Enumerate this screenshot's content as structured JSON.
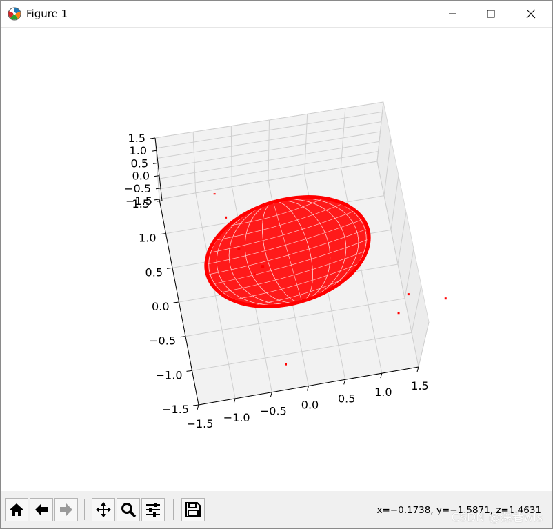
{
  "window": {
    "title": "Figure 1",
    "icon": "matplotlib-icon",
    "controls": [
      "minimize-icon",
      "maximize-icon",
      "close-icon"
    ]
  },
  "toolbar": {
    "buttons": [
      {
        "name": "home",
        "icon": "home-icon"
      },
      {
        "name": "back",
        "icon": "arrow-left-icon"
      },
      {
        "name": "forward",
        "icon": "arrow-right-icon"
      },
      {
        "name": "pan",
        "icon": "move-icon"
      },
      {
        "name": "zoom",
        "icon": "magnifier-icon"
      },
      {
        "name": "configure-subplots",
        "icon": "sliders-icon"
      },
      {
        "name": "save",
        "icon": "floppy-disk-icon"
      }
    ],
    "coordinates": "x=−0.1738, y=−1.5871, z=1.4631"
  },
  "watermark": "CSDN @深巷wls",
  "chart_data": {
    "type": "scatter",
    "projection": "3d",
    "title": "",
    "series": [
      {
        "color": "#ff0000",
        "style": "wireframe surface (red ellipsoid) with scattered red points"
      }
    ],
    "x_ticks": [
      "−1.5",
      "−1.0",
      "−0.5",
      "0.0",
      "0.5",
      "1.0",
      "1.5"
    ],
    "y_ticks": [
      "−1.5",
      "−1.0",
      "−0.5",
      "0.0",
      "0.5",
      "1.0",
      "1.5"
    ],
    "z_ticks": [
      "1.5",
      "1.0",
      "0.5",
      "0.0",
      "−0.5",
      "−1.5"
    ],
    "xlim": [
      -1.5,
      1.5
    ],
    "ylim": [
      -1.5,
      1.5
    ],
    "zlim": [
      -1.5,
      1.5
    ],
    "grid": true
  }
}
